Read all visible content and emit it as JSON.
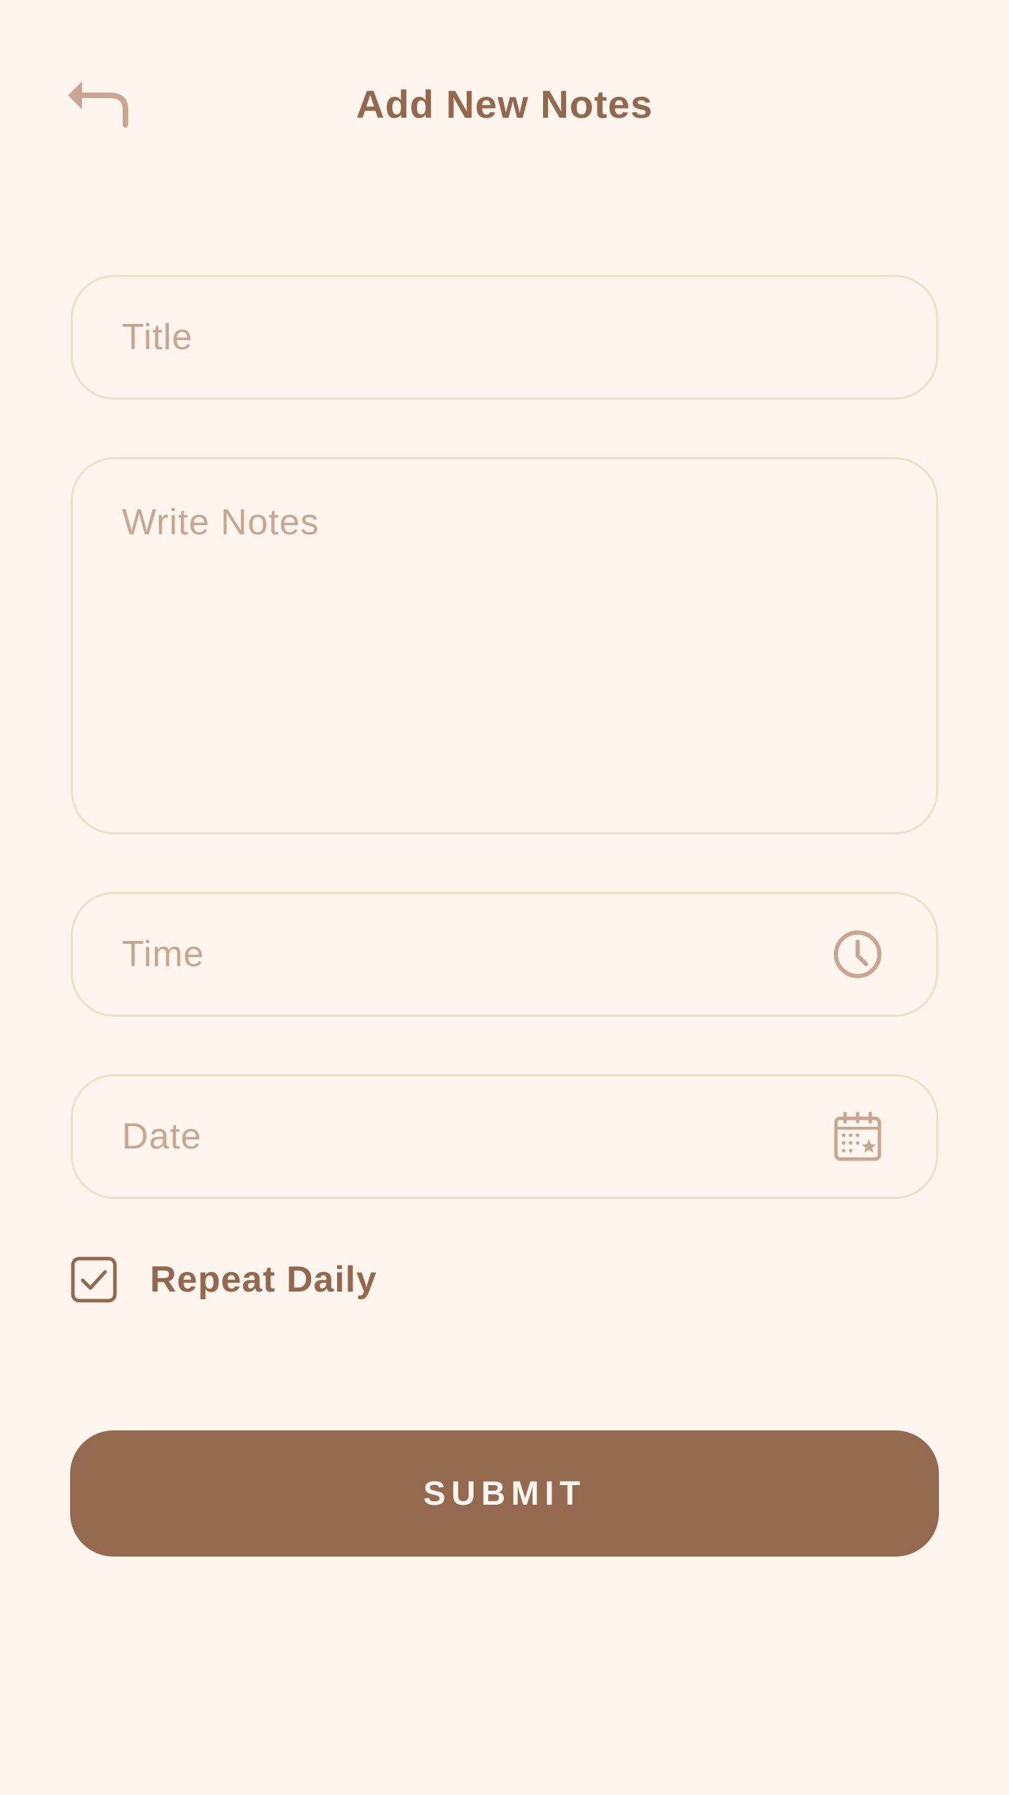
{
  "header": {
    "title": "Add New Notes",
    "back_icon": "undo-arrow-icon"
  },
  "form": {
    "title_field": {
      "value": "",
      "placeholder": "Title"
    },
    "notes_field": {
      "value": "",
      "placeholder": "Write Notes"
    },
    "time_field": {
      "value": "",
      "placeholder": "Time",
      "icon": "clock-icon"
    },
    "date_field": {
      "value": "",
      "placeholder": "Date",
      "icon": "calendar-icon"
    },
    "repeat_daily": {
      "label": "Repeat Daily",
      "checked": true
    },
    "submit_label": "SUBMIT"
  },
  "colors": {
    "background": "#FDF5EE",
    "primary": "#94684E",
    "field_border": "#F1DEC6",
    "placeholder": "#C9A692",
    "icon": "#C9A692"
  }
}
